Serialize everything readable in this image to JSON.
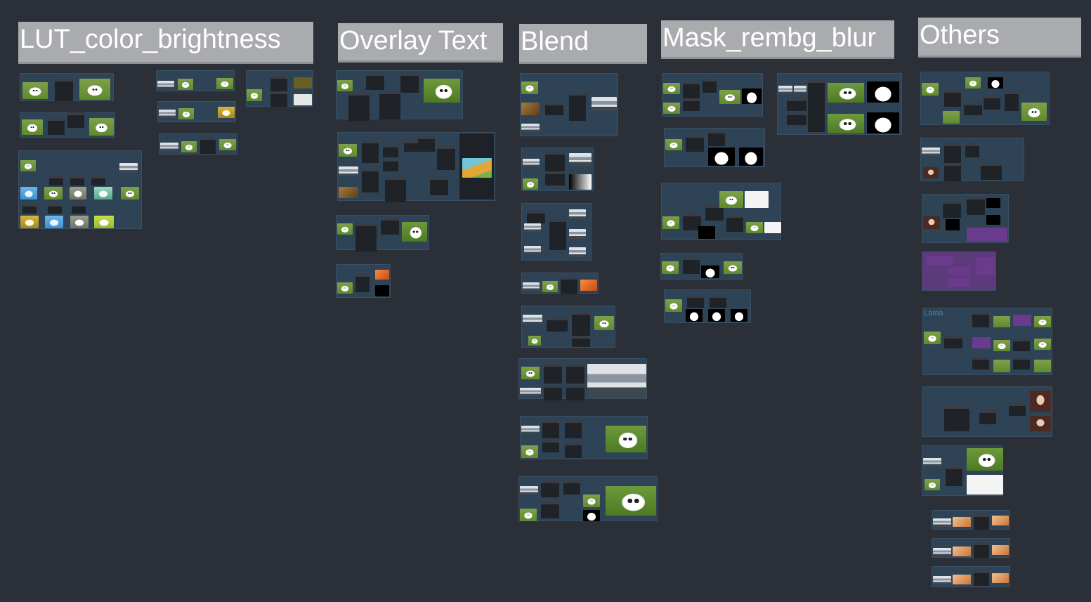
{
  "groups": {
    "lut": {
      "title": "LUT_color_brightness"
    },
    "overlay": {
      "title": "Overlay Text"
    },
    "blend": {
      "title": "Blend"
    },
    "mask": {
      "title": "Mask_rembg_blur"
    },
    "others": {
      "title": "Others"
    }
  },
  "labels": {
    "lama": "Lama"
  },
  "colors": {
    "canvas_bg": "#2b2f38",
    "group_title_bg": "#a9abae",
    "group_bg": "#2f4356",
    "node_bg": "#1f2227",
    "accent_purple": "#6a3a8c"
  },
  "icons": [
    "image-thumbnail-icon",
    "mask-preview-icon"
  ]
}
